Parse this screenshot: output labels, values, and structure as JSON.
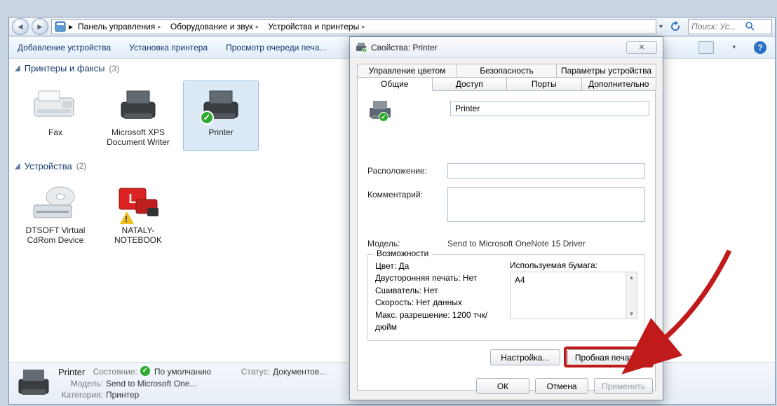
{
  "nav": {
    "crumbs": [
      "Панель управления",
      "Оборудование и звук",
      "Устройства и принтеры"
    ],
    "search_placeholder": "Поиск: Ус..."
  },
  "toolbar": {
    "add_device": "Добавление устройства",
    "install_printer": "Установка принтера",
    "view_queue": "Просмотр очереди печа..."
  },
  "groups": {
    "printers": {
      "title": "Принтеры и факсы",
      "count": "(3)"
    },
    "devices": {
      "title": "Устройства",
      "count": "(2)"
    }
  },
  "items": {
    "fax": "Fax",
    "xps": "Microsoft XPS Document Writer",
    "printer": "Printer",
    "cdrom": "DTSOFT Virtual CdRom Device",
    "notebook": "NATALY-NOTEBOOK"
  },
  "details": {
    "name": "Printer",
    "state_label": "Состояние:",
    "state_value": "По умолчанию",
    "model_label": "Модель:",
    "model_value": "Send to Microsoft One...",
    "category_label": "Категория:",
    "category_value": "Принтер",
    "status_label": "Статус:",
    "status_value": "Документов..."
  },
  "dialog": {
    "title": "Свойства: Printer",
    "tabs_back": [
      "Управление цветом",
      "Безопасность",
      "Параметры устройства"
    ],
    "tabs_front": [
      "Общие",
      "Доступ",
      "Порты",
      "Дополнительно"
    ],
    "name_value": "Printer",
    "location_label": "Расположение:",
    "comment_label": "Комментарий:",
    "model_label": "Модель:",
    "model_value": "Send to Microsoft OneNote 15 Driver",
    "caps_legend": "Возможности",
    "caps_lines": {
      "color": "Цвет: Да",
      "duplex": "Двусторонняя печать: Нет",
      "stapler": "Сшиватель: Нет",
      "speed": "Скорость: Нет данных",
      "maxres": "Макс. разрешение: 1200 тчк/дюйм"
    },
    "paper_label": "Используемая бумага:",
    "paper_item": "A4",
    "btn_settings": "Настройка...",
    "btn_testprint": "Пробная печать",
    "btn_ok": "ОК",
    "btn_cancel": "Отмена",
    "btn_apply": "Применить"
  }
}
